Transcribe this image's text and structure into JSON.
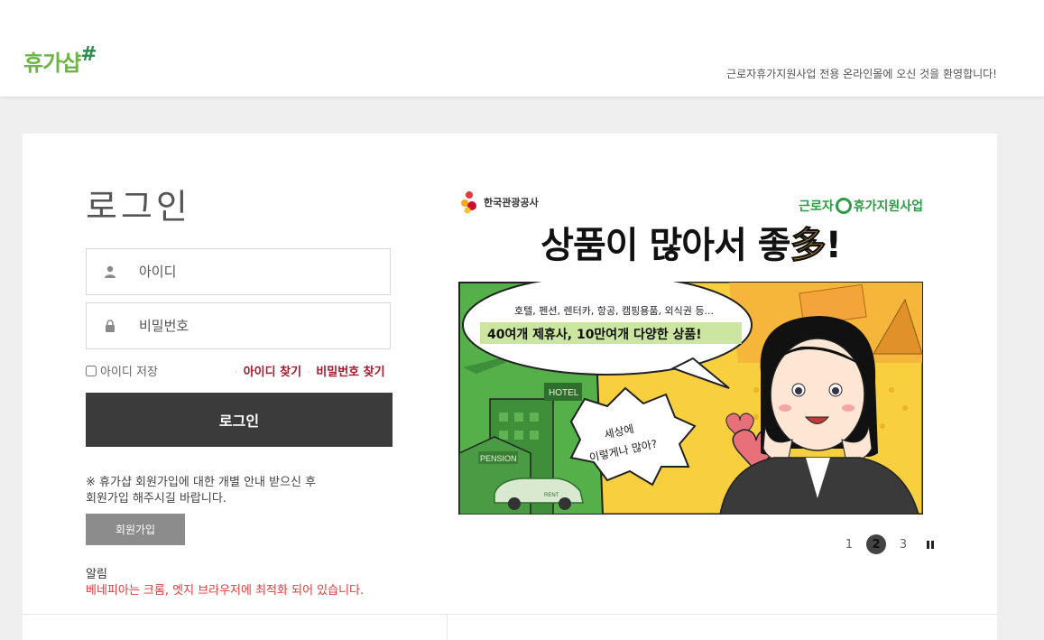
{
  "header": {
    "logo_text": "휴가샵",
    "logo_mark": "#",
    "welcome": "근로자휴가지원사업 전용 온라인몰에 오신 것을 환영합니다!"
  },
  "login": {
    "title": "로그인",
    "id_placeholder": "아이디",
    "pw_placeholder": "비밀번호",
    "save_id_label": "아이디 저장",
    "find_id": "아이디 찾기",
    "find_pw": "비밀번호 찾기",
    "link_separator": "·",
    "submit_label": "로그인",
    "notice_line1": "※ 휴가샵 회원가입에 대한 개별 안내 받으신 후",
    "notice_line2": "회원가입 해주시길 바랍니다.",
    "join_label": "회원가입",
    "alert_title": "알림",
    "alert_text": "베네피아는 크롬, 엣지 브라우저에 최적화 되어 있습니다."
  },
  "banner": {
    "org": "한국관광공사",
    "program_pre": "근로자",
    "program_post": "휴가지원사업",
    "headline_main": "상품이 많아서 좋",
    "headline_many": "多",
    "headline_end": "!",
    "bubble_line1": "호텔, 펜션, 렌터카, 항공, 캠핑용품, 외식권 등...",
    "bubble_line2": "40여개 제휴사, 10만여개 다양한 상품!",
    "small_bubble_line1": "세상에",
    "small_bubble_line2": "이렇게나 많아?",
    "sign_hotel": "HOTEL",
    "sign_pension": "PENSION",
    "car_label": "RENT"
  },
  "pager": {
    "pages": [
      "1",
      "2",
      "3"
    ],
    "active_index": 1
  },
  "colors": {
    "brand_green": "#6bb545",
    "login_button": "#3b3b3b",
    "find_links": "#a8172a",
    "alert": "#e23b3b"
  },
  "icons": {
    "id_field": "user-icon",
    "pw_field": "lock-icon",
    "pause": "pause-icon"
  }
}
